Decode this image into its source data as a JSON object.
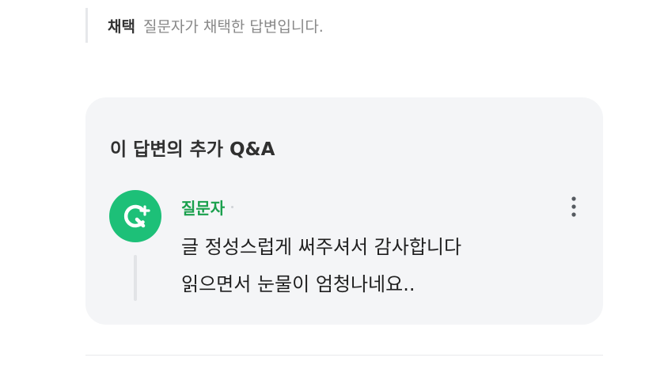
{
  "adopted_note": {
    "tag": "채택",
    "description": "질문자가 채택한 답변입니다."
  },
  "qa_section": {
    "title": "이 답변의 추가 Q&A",
    "comment": {
      "author": "질문자",
      "avatar_icon": "q-plus-icon",
      "more_icon": "more-vertical-icon",
      "lines": [
        "글 정성스럽게 써주셔서 감사합니다",
        "읽으면서 눈물이 엄청나네요.."
      ]
    }
  },
  "colors": {
    "brand_green": "#1dc078",
    "author_green": "#1aa04d",
    "card_background": "#f4f5f7"
  }
}
